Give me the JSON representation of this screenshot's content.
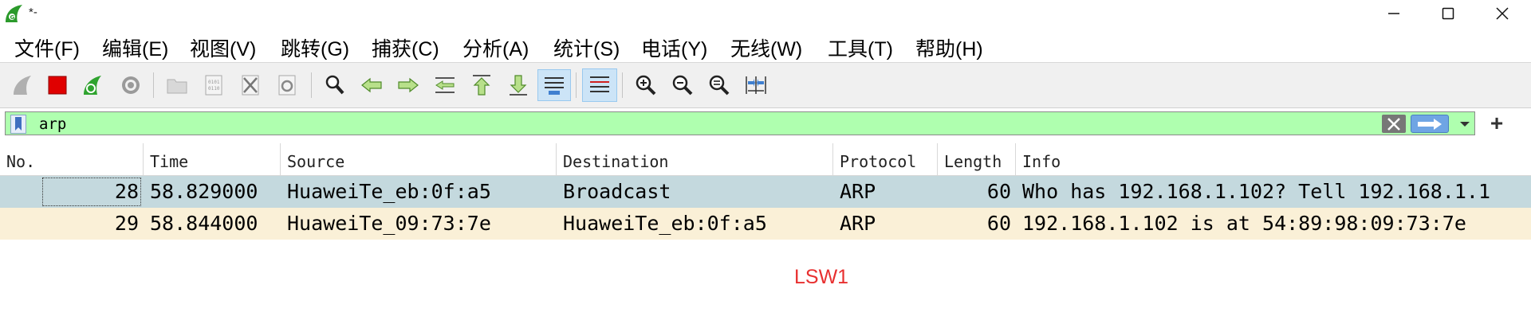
{
  "window": {
    "title": "*-",
    "controls": [
      "minimize",
      "maximize",
      "close"
    ]
  },
  "menu": {
    "items": [
      "文件(F)",
      "编辑(E)",
      "视图(V)",
      "跳转(G)",
      "捕获(C)",
      "分析(A)",
      "统计(S)",
      "电话(Y)",
      "无线(W)",
      "工具(T)",
      "帮助(H)"
    ]
  },
  "toolbar": {
    "buttons": [
      "start-capture",
      "stop-capture",
      "restart-capture",
      "capture-options",
      "open-file",
      "save-file",
      "close-file",
      "reload-file",
      "find-packet",
      "go-back",
      "go-forward",
      "go-to-packet",
      "go-first",
      "go-last",
      "auto-scroll",
      "colorize",
      "zoom-in",
      "zoom-out",
      "zoom-normal",
      "resize-columns"
    ]
  },
  "filter": {
    "value": "arp",
    "background": "#afffaf"
  },
  "packet_list": {
    "columns": [
      "No.",
      "Time",
      "Source",
      "Destination",
      "Protocol",
      "Length",
      "Info"
    ],
    "rows": [
      {
        "no": "28",
        "time": "58.829000",
        "source": "HuaweiTe_eb:0f:a5",
        "destination": "Broadcast",
        "protocol": "ARP",
        "length": "60",
        "info": "Who has 192.168.1.102? Tell 192.168.1.1",
        "color": "#c4d9de",
        "selected": true
      },
      {
        "no": "29",
        "time": "58.844000",
        "source": "HuaweiTe_09:73:7e",
        "destination": "HuaweiTe_eb:0f:a5",
        "protocol": "ARP",
        "length": "60",
        "info": "192.168.1.102 is at 54:89:98:09:73:7e",
        "color": "#faf0d7",
        "selected": false
      }
    ]
  },
  "annotation": {
    "text": "LSW1",
    "color": "#e83030"
  }
}
